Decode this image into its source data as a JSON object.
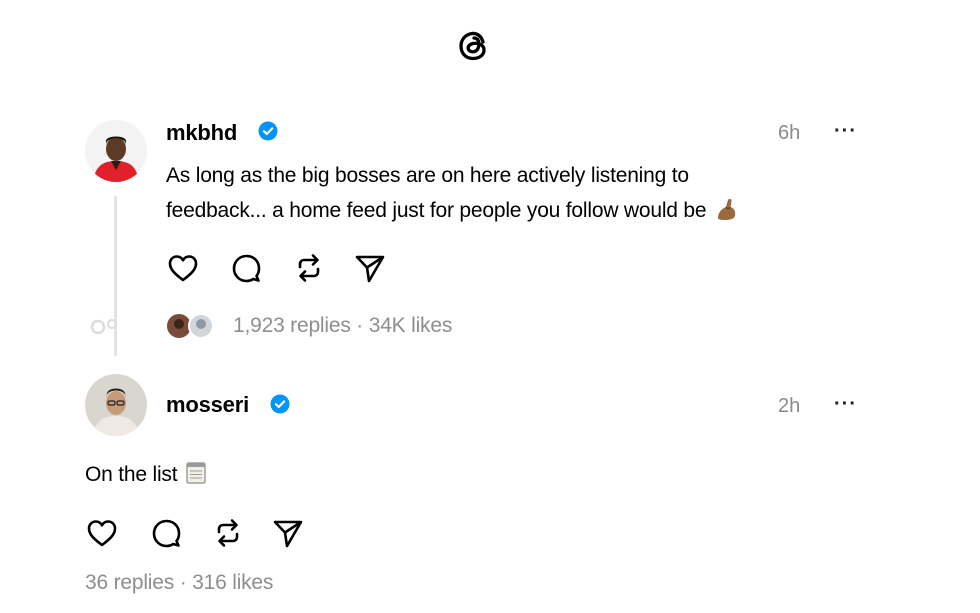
{
  "app": {
    "logo_icon": "threads-logo-icon"
  },
  "posts": [
    {
      "username": "mkbhd",
      "verified": true,
      "time": "6h",
      "more": "···",
      "text_line1": "As long as the big bosses are on here actively listening to",
      "text_line2": "feedback... a home feed just for people you follow would be",
      "emoji_icon": "pinched-fingers-icon",
      "replies": "1,923 replies",
      "separator": " · ",
      "likes": "34K likes"
    },
    {
      "username": "mosseri",
      "verified": true,
      "time": "2h",
      "more": "···",
      "text": "On the list",
      "emoji_icon": "notepad-icon",
      "replies": "36 replies",
      "separator": " · ",
      "likes": "316 likes"
    }
  ],
  "actions": [
    "heart-icon",
    "comment-icon",
    "repost-icon",
    "share-icon"
  ],
  "colors": {
    "verified": "#0095f6",
    "muted": "#8e8e8e",
    "thread_line": "#e3e3e3"
  }
}
